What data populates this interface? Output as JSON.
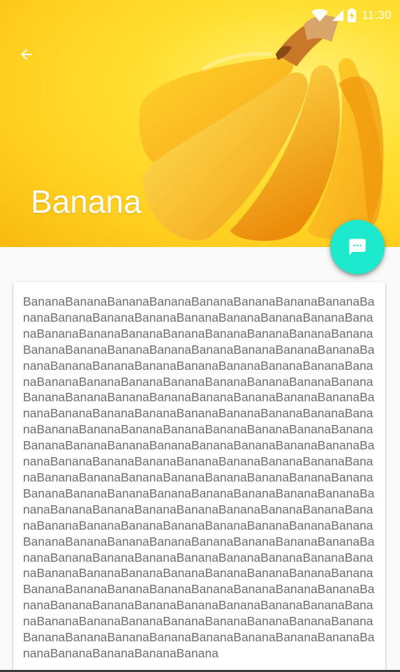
{
  "status_bar": {
    "time": "11:30"
  },
  "toolbar": {
    "title": "Banana"
  },
  "content": {
    "body_text": "BananaBananaBananaBananaBananaBananaBananaBananaBananaBananaBananaBananaBananaBananaBananaBananaBananaBananaBananaBananaBananaBananaBananaBananaBananaBananaBananaBananaBananaBananaBananaBananaBananaBananaBananaBananaBananaBananaBananaBananaBananaBananaBananaBananaBananaBananaBananaBananaBananaBananaBananaBananaBananaBananaBananaBananaBananaBananaBananaBananaBananaBananaBananaBananaBananaBananaBananaBananaBananaBananaBananaBananaBananaBananaBananaBananaBananaBananaBananaBananaBananaBananaBananaBananaBananaBananaBananaBananaBananaBananaBananaBananaBananaBananaBananaBananaBananaBananaBananaBananaBananaBananaBananaBananaBananaBananaBananaBananaBananaBananaBananaBananaBananaBananaBananaBananaBananaBananaBananaBananaBananaBananaBananaBananaBananaBananaBananaBananaBananaBananaBananaBananaBananaBananaBananaBananaBananaBananaBananaBananaBananaBananaBananaBananaBananaBananaBananaBananaBananaBananaBananaBananaBananaBananaBananaBananaBananaBananaBananaBananaBananaBananaBananaBananaBananaBananaBananaBananaBananaBananaBananaBananaBananaBananaBananaBananaBananaBananaBananaBananaBananaBananaBananaBananaBananaBananaBananaBanana"
  },
  "icons": {
    "back": "arrow-back-icon",
    "fab": "message-icon",
    "wifi": "wifi-icon",
    "signal": "cell-signal-icon",
    "battery": "battery-charging-icon"
  },
  "colors": {
    "fab": "#1de9cf",
    "title": "#ffffff",
    "body_text": "#6e6e6e",
    "background": "#fafafa"
  }
}
